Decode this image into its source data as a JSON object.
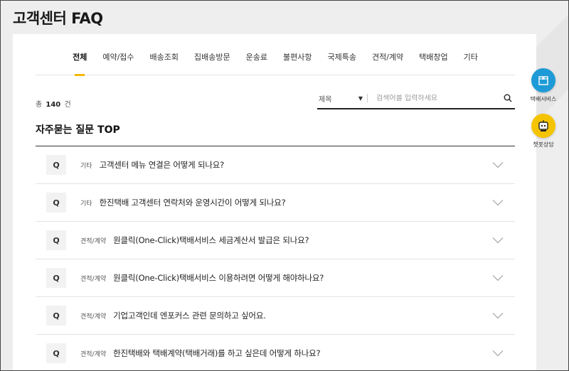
{
  "page": {
    "title": "고객센터 FAQ"
  },
  "tabs": [
    {
      "label": "전체",
      "active": true
    },
    {
      "label": "예약/접수"
    },
    {
      "label": "배송조회"
    },
    {
      "label": "집배송방문"
    },
    {
      "label": "운송료"
    },
    {
      "label": "불편사항"
    },
    {
      "label": "국제특송"
    },
    {
      "label": "견적/계약"
    },
    {
      "label": "택배창업"
    },
    {
      "label": "기타"
    }
  ],
  "count": {
    "prefix": "총",
    "number": "140",
    "suffix": "건"
  },
  "search": {
    "select_value": "제목",
    "placeholder": "검색어를 입력하세요"
  },
  "section": {
    "title": "자주묻는 질문 TOP"
  },
  "faq": [
    {
      "badge": "Q",
      "category": "기타",
      "question": "고객센터 메뉴 연결은 어떻게 되나요?"
    },
    {
      "badge": "Q",
      "category": "기타",
      "question": "한진택배 고객센터 연락처와 운영시간이 어떻게 되나요?"
    },
    {
      "badge": "Q",
      "category": "견적/계약",
      "question": "원클릭(One-Click)택배서비스 세금계산서 발급은 되나요?"
    },
    {
      "badge": "Q",
      "category": "견적/계약",
      "question": "원클릭(One-Click)택배서비스 이용하려면 어떻게 해야하나요?"
    },
    {
      "badge": "Q",
      "category": "견적/계약",
      "question": "기업고객인데 엔포커스 관련 문의하고 싶어요."
    },
    {
      "badge": "Q",
      "category": "견적/계약",
      "question": "한진택배와 택배계약(택배거래)를 하고 싶은데 어떻게 하나요?"
    }
  ],
  "floating": {
    "parcel_service": "택배서비스",
    "chatbot": "챗봇상담"
  },
  "colors": {
    "accent": "#f5b800",
    "service_button": "#1e9bd7",
    "chatbot_button": "#f5c400"
  },
  "icons": {
    "search": "search-icon",
    "expand": "chevron-down-icon",
    "parcel": "box-icon",
    "chatbot": "robot-icon"
  }
}
